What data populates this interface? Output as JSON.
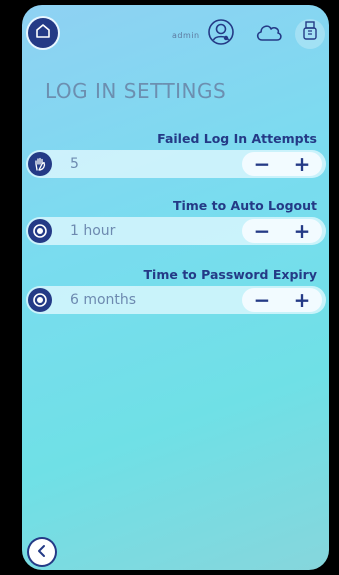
{
  "header": {
    "user_label": "admin",
    "icons": [
      "home-icon",
      "user-icon",
      "cloud-icon",
      "usb-icon"
    ]
  },
  "page": {
    "title": "LOG IN SETTINGS"
  },
  "settings": [
    {
      "label": "Failed Log In Attempts",
      "value": "5",
      "icon": "hand-icon",
      "minus": "−",
      "plus": "+"
    },
    {
      "label": "Time to Auto Logout",
      "value": "1 hour",
      "icon": "dial-icon",
      "minus": "−",
      "plus": "+"
    },
    {
      "label": "Time to Password Expiry",
      "value": "6 months",
      "icon": "dial-icon",
      "minus": "−",
      "plus": "+"
    }
  ],
  "colors": {
    "primary": "#243a86",
    "title": "#6c8fb0",
    "background_start": "#8fd1f3",
    "background_end": "#6fe0e6"
  }
}
